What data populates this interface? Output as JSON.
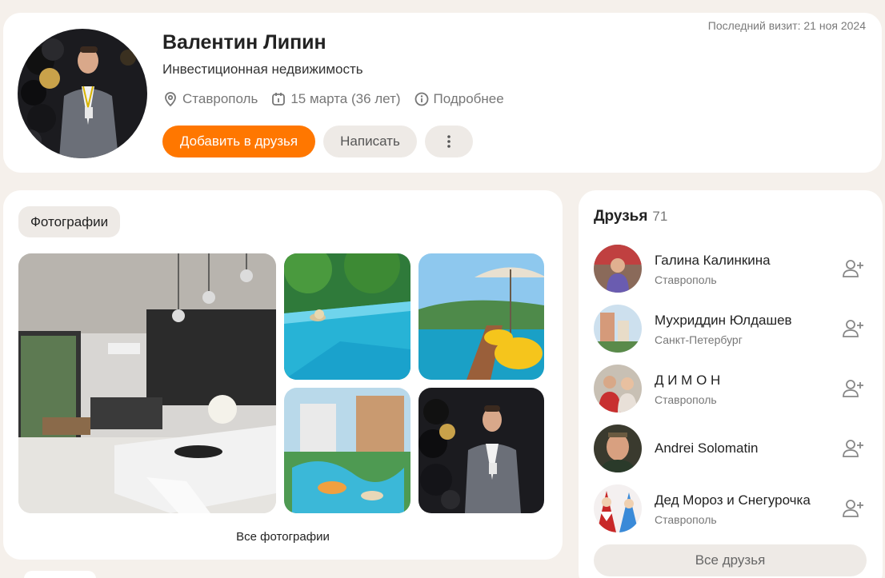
{
  "profile": {
    "last_visit": "Последний визит: 21 ноя 2024",
    "name": "Валентин Липин",
    "title": "Инвестиционная недвижимость",
    "city": "Ставрополь",
    "birthday": "15 марта (36 лет)",
    "more": "Подробнее",
    "add_friend": "Добавить в друзья",
    "message": "Написать"
  },
  "photos": {
    "tab": "Фотографии",
    "all_label": "Все фотографии"
  },
  "friends": {
    "title": "Друзья",
    "count": "71",
    "items": [
      {
        "name": "Галина Калинкина",
        "city": "Ставрополь"
      },
      {
        "name": "Мухриддин Юлдашев",
        "city": "Санкт-Петербург"
      },
      {
        "name": "Д И М О Н",
        "city": "Ставрополь"
      },
      {
        "name": "Andrei Solomatin",
        "city": ""
      },
      {
        "name": "Дед Мороз и Снегурочка",
        "city": "Ставрополь"
      }
    ],
    "all_label": "Все друзья"
  },
  "colors": {
    "accent": "#ff7700",
    "background": "#f5f0eb",
    "button_gray": "#eeeae6"
  },
  "icons": {
    "location": "location-icon",
    "calendar": "calendar-icon",
    "info": "info-icon",
    "more": "more-vertical-icon",
    "add_friend": "add-friend-icon"
  }
}
